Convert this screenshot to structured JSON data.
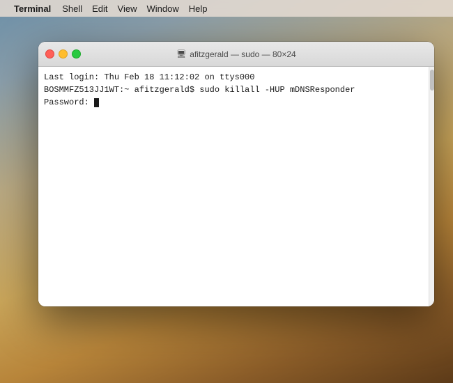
{
  "menubar": {
    "apple_symbol": "",
    "app_name": "Terminal",
    "items": [
      "Shell",
      "Edit",
      "View",
      "Window",
      "Help"
    ]
  },
  "terminal": {
    "title": "afitzgerald — sudo — 80×24",
    "title_icon": "🖥",
    "lines": [
      "Last login: Thu Feb 18 11:12:02 on ttys000",
      "BOSMMFZ513JJ1WT:~ afitzgerald$ sudo killall -HUP mDNSResponder",
      "Password: "
    ]
  }
}
